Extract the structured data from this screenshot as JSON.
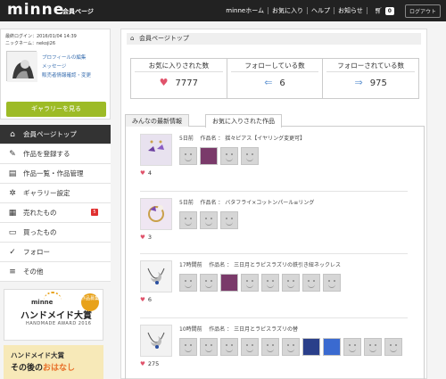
{
  "header": {
    "logo": "minne",
    "subtitle": "会員ページ",
    "nav": [
      "minneホーム",
      "お気に入り",
      "ヘルプ",
      "お知らせ"
    ],
    "cart_count": "0",
    "logout": "ログアウト"
  },
  "profile": {
    "last_login": "最終ログイン：2016/01/04 14:39",
    "nickname": "ニックネーム：nekoji26",
    "links": [
      "プロフィールの編集",
      "メッセージ",
      "販売者情報確認・変更"
    ],
    "gallery_button": "ギャラリーを見る"
  },
  "menu": [
    {
      "label": "会員ページトップ",
      "icon": "home-icon",
      "glyph": "⌂",
      "active": true
    },
    {
      "label": "作品を登録する",
      "icon": "edit-icon",
      "glyph": "✎",
      "active": false
    },
    {
      "label": "作品一覧・作品管理",
      "icon": "document-icon",
      "glyph": "▤",
      "active": false
    },
    {
      "label": "ギャラリー設定",
      "icon": "wrench-icon",
      "glyph": "✲",
      "active": false
    },
    {
      "label": "売れたもの",
      "icon": "calendar-icon",
      "glyph": "▦",
      "active": false,
      "badge": "5"
    },
    {
      "label": "買ったもの",
      "icon": "cart-icon",
      "glyph": "▭",
      "active": false
    },
    {
      "label": "フォロー",
      "icon": "check-icon",
      "glyph": "✓",
      "active": false
    },
    {
      "label": "その他",
      "icon": "list-icon",
      "glyph": "≡",
      "active": false
    }
  ],
  "banners": {
    "award_minne": "minne",
    "award_title": "ハンドメイド大賞",
    "award_sub": "HANDMADE AWARD 2016",
    "award_badge": "作品募集",
    "b2_line1": "ハンドメイド大賞",
    "b2_line2_a": "その後の",
    "b2_line2_b": "おはなし"
  },
  "main": {
    "section_title": "会員ページトップ",
    "stats": [
      {
        "label": "お気に入りされた数",
        "value": "7777",
        "icon": "heart-icon",
        "glyph": "♥",
        "color": "#e0536b"
      },
      {
        "label": "フォローしている数",
        "value": "6",
        "icon": "follow-icon",
        "glyph": "⇐",
        "color": "#6a9ad4"
      },
      {
        "label": "フォローされている数",
        "value": "975",
        "icon": "followed-icon",
        "glyph": "⇒",
        "color": "#6a9ad4"
      }
    ],
    "tabs": [
      "みんなの最新情報",
      "お気に入りされた作品"
    ],
    "entries": [
      {
        "time": "5日前",
        "title": "作品名 ： 揺々ピアス【イヤリング変更可】",
        "likes": "4",
        "faces": 4,
        "photos": [
          1
        ]
      },
      {
        "time": "5日前",
        "title": "作品名 ： バタフライ×コットンパール≡リング",
        "likes": "3",
        "faces": 3,
        "photos": []
      },
      {
        "time": "17時間前",
        "title": "作品名 ： 三日月とラピスラズリの鉄引き紐ネックレス",
        "likes": "6",
        "faces": 8,
        "photos": [
          2
        ]
      },
      {
        "time": "10時間前",
        "title": "作品名 ： 三日月とラピスラズリの替",
        "likes": "275",
        "faces": 11,
        "photos": [
          6,
          7
        ]
      }
    ]
  }
}
